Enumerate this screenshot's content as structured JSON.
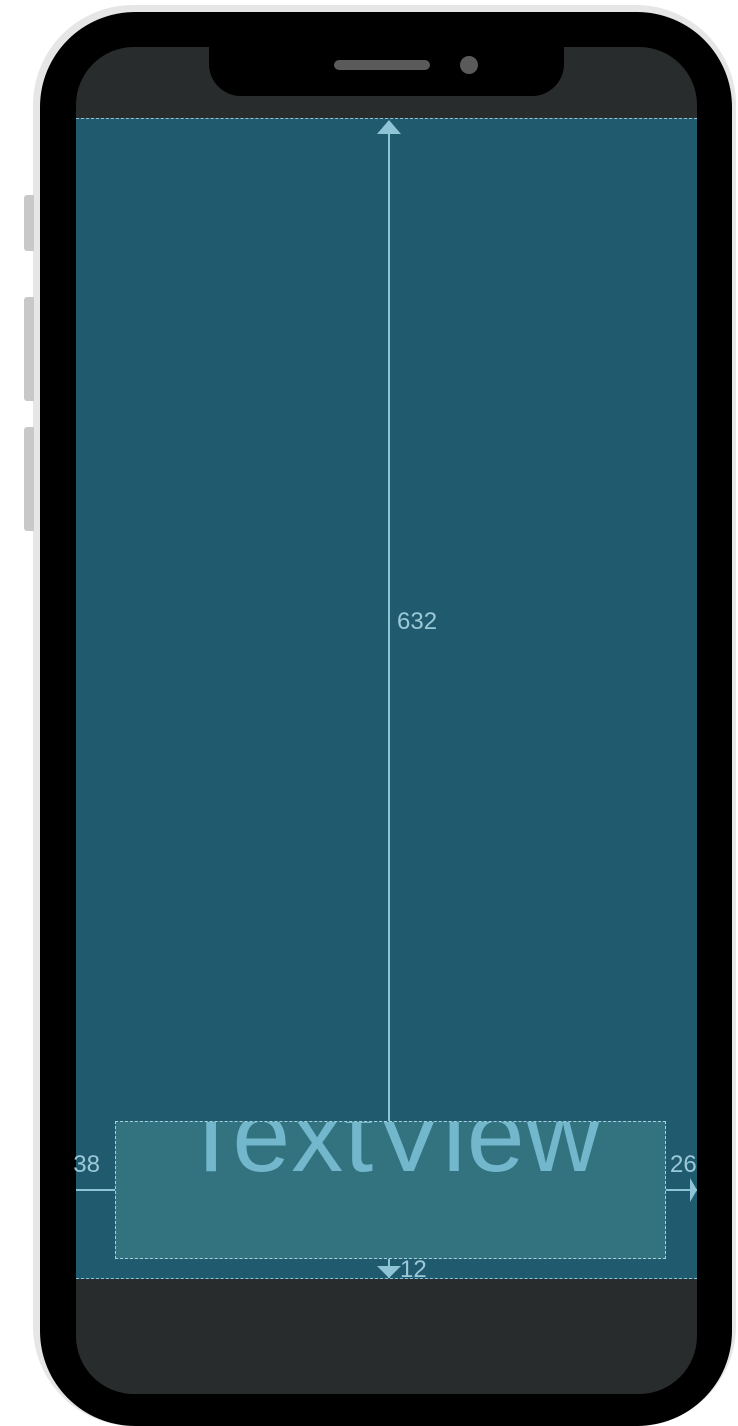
{
  "device": {
    "frame_color": "#000000",
    "bezel_color": "#e6e6e6",
    "screen_background": "#292c2c"
  },
  "layout_editor": {
    "background_color": "#205a6e",
    "constraint_color": "#8fc4d6",
    "widget": {
      "type": "TextView",
      "text": "TextView",
      "text_color": "#72b7cc",
      "background_color": "#33737f"
    },
    "constraints": {
      "top": "632",
      "start": "38",
      "end": "26",
      "bottom": "12"
    }
  }
}
